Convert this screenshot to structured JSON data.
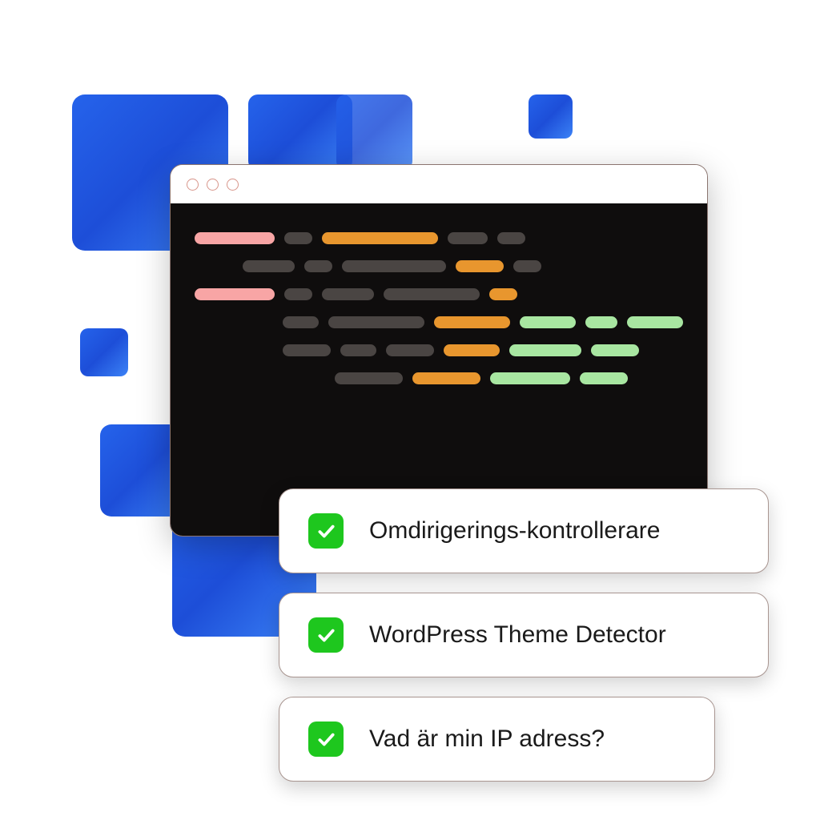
{
  "features": [
    {
      "label": "Omdirigerings-kontrollerare"
    },
    {
      "label": "WordPress Theme Detector"
    },
    {
      "label": "Vad är min IP adress?"
    }
  ],
  "colors": {
    "blue_gradient_start": "#2563eb",
    "blue_gradient_end": "#3b82f6",
    "check_green": "#1ec71e",
    "code_bg": "#0f0d0d",
    "token_pink": "#f8a5a5",
    "token_orange": "#e8962e",
    "token_green": "#a8e6a1",
    "token_gray": "#4a4543"
  }
}
